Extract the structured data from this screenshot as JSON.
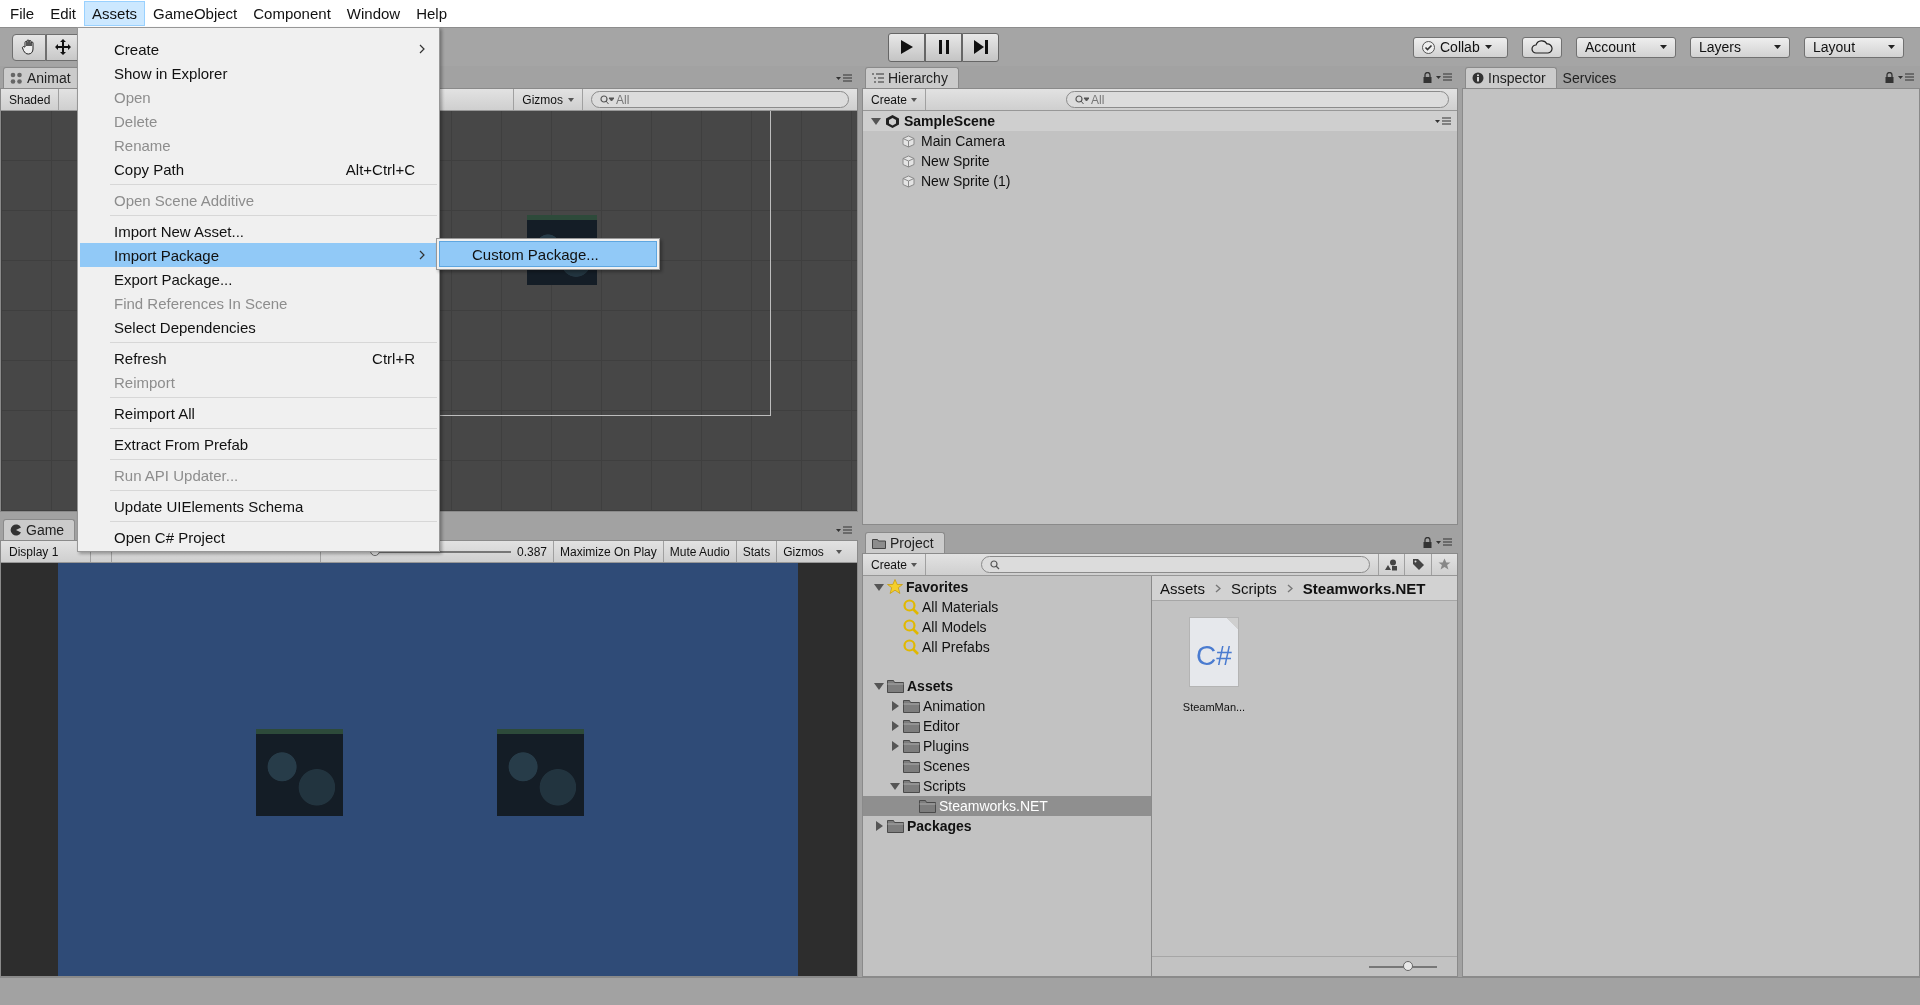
{
  "menubar": [
    {
      "label": "File",
      "selected": false
    },
    {
      "label": "Edit",
      "selected": false
    },
    {
      "label": "Assets",
      "selected": true
    },
    {
      "label": "GameObject",
      "selected": false
    },
    {
      "label": "Component",
      "selected": false
    },
    {
      "label": "Window",
      "selected": false
    },
    {
      "label": "Help",
      "selected": false
    }
  ],
  "assets_menu": {
    "groups": [
      [
        {
          "label": "Create",
          "disabled": false,
          "selected": false,
          "has_submenu": true
        },
        {
          "label": "Show in Explorer",
          "disabled": false,
          "selected": false
        },
        {
          "label": "Open",
          "disabled": true,
          "selected": false
        },
        {
          "label": "Delete",
          "disabled": true,
          "selected": false
        },
        {
          "label": "Rename",
          "disabled": true,
          "selected": false
        },
        {
          "label": "Copy Path",
          "shortcut": "Alt+Ctrl+C",
          "disabled": false,
          "selected": false
        }
      ],
      [
        {
          "label": "Open Scene Additive",
          "disabled": true,
          "selected": false
        }
      ],
      [
        {
          "label": "Import New Asset...",
          "disabled": false,
          "selected": false
        },
        {
          "label": "Import Package",
          "disabled": false,
          "selected": true,
          "has_submenu": true
        },
        {
          "label": "Export Package...",
          "disabled": false,
          "selected": false
        },
        {
          "label": "Find References In Scene",
          "disabled": true,
          "selected": false
        },
        {
          "label": "Select Dependencies",
          "disabled": false,
          "selected": false
        }
      ],
      [
        {
          "label": "Refresh",
          "shortcut": "Ctrl+R",
          "disabled": false,
          "selected": false
        },
        {
          "label": "Reimport",
          "disabled": true,
          "selected": false
        }
      ],
      [
        {
          "label": "Reimport All",
          "disabled": false,
          "selected": false
        }
      ],
      [
        {
          "label": "Extract From Prefab",
          "disabled": false,
          "selected": false
        }
      ],
      [
        {
          "label": "Run API Updater...",
          "disabled": true,
          "selected": false
        }
      ],
      [
        {
          "label": "Update UIElements Schema",
          "disabled": false,
          "selected": false
        }
      ],
      [
        {
          "label": "Open C# Project",
          "disabled": false,
          "selected": false
        }
      ]
    ]
  },
  "import_package_submenu": [
    {
      "label": "Custom Package...",
      "selected": true
    }
  ],
  "toolbar": {
    "buttons": [
      {
        "label": "Collab",
        "kind": "collab"
      },
      {
        "kind": "cloud"
      },
      {
        "label": "Account",
        "kind": "dropdown"
      },
      {
        "label": "Layers",
        "kind": "dropdown"
      },
      {
        "label": "Layout",
        "kind": "dropdown"
      }
    ]
  },
  "scene_panel": {
    "tab": "Animat",
    "shading": "Shaded",
    "gizmos": "Gizmos",
    "search_placeholder": "All"
  },
  "game_panel": {
    "tab": "Game",
    "display": "Display 1",
    "scale": {
      "level": 0.03
    },
    "scale_value": "0.387",
    "buttons": [
      "Maximize On Play",
      "Mute Audio",
      "Stats",
      "Gizmos"
    ]
  },
  "hierarchy": {
    "tab": "Hierarchy",
    "create": "Create",
    "search_placeholder": "All",
    "scene": {
      "label": "SampleScene",
      "expanded": true
    },
    "objects": [
      "Main Camera",
      "New Sprite",
      "New Sprite (1)"
    ]
  },
  "inspector": {
    "tabs": [
      {
        "label": "Inspector",
        "selected": true
      },
      {
        "label": "Services",
        "selected": false
      }
    ]
  },
  "project": {
    "tab": "Project",
    "create": "Create",
    "tree": [
      {
        "label": "Favorites",
        "kind": "favorites",
        "expanded": true,
        "selected": false,
        "children": [
          {
            "label": "All Materials",
            "kind": "saved_search",
            "selected": false
          },
          {
            "label": "All Models",
            "kind": "saved_search",
            "selected": false
          },
          {
            "label": "All Prefabs",
            "kind": "saved_search",
            "selected": false
          }
        ]
      },
      {
        "label": "Assets",
        "kind": "folder",
        "expanded": true,
        "selected": false,
        "children": [
          {
            "label": "Animation",
            "kind": "folder",
            "expanded": false,
            "selected": false
          },
          {
            "label": "Editor",
            "kind": "folder",
            "expanded": false,
            "selected": false
          },
          {
            "label": "Plugins",
            "kind": "folder",
            "expanded": false,
            "selected": false
          },
          {
            "label": "Scenes",
            "kind": "folder",
            "selected": false
          },
          {
            "label": "Scripts",
            "kind": "folder",
            "expanded": true,
            "selected": false,
            "children": [
              {
                "label": "Steamworks.NET",
                "kind": "folder",
                "selected": true
              }
            ]
          }
        ]
      },
      {
        "label": "Packages",
        "kind": "folder",
        "expanded": false,
        "selected": false
      }
    ],
    "breadcrumb": [
      "Assets",
      "Scripts",
      "Steamworks.NET"
    ],
    "files": [
      {
        "label": "SteamMan...",
        "type_label": "C#"
      }
    ],
    "icon_size": {
      "level": 0.58
    }
  }
}
